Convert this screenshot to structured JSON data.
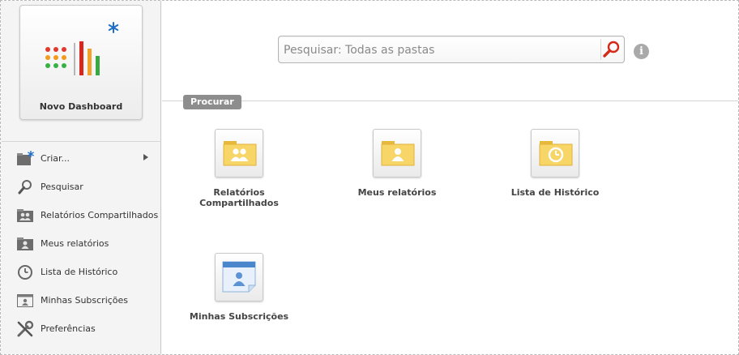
{
  "sidebar": {
    "dashboard_tile": {
      "label": "Novo Dashboard",
      "icon": "dashboard-chart-icon"
    },
    "menu": [
      {
        "label": "Criar...",
        "icon": "create-folder-icon",
        "has_submenu": true
      },
      {
        "label": "Pesquisar",
        "icon": "search-icon"
      },
      {
        "label": "Relatórios Compartilhados",
        "icon": "shared-reports-icon"
      },
      {
        "label": "Meus relatórios",
        "icon": "my-reports-icon"
      },
      {
        "label": "Lista de Histórico",
        "icon": "history-icon"
      },
      {
        "label": "Minhas Subscrições",
        "icon": "subscriptions-icon"
      },
      {
        "label": "Preferências",
        "icon": "preferences-icon"
      }
    ]
  },
  "search": {
    "placeholder": "Pesquisar: Todas as pastas",
    "value": "",
    "button_icon": "search-icon",
    "info_icon": "info-icon",
    "info_glyph": "i"
  },
  "browse": {
    "label": "Procurar",
    "tiles": [
      {
        "label": "Relatórios Compartilhados",
        "icon": "shared-reports-folder-icon"
      },
      {
        "label": "Meus relatórios",
        "icon": "my-reports-folder-icon"
      },
      {
        "label": "Lista de Histórico",
        "icon": "history-folder-icon"
      },
      {
        "label": "Minhas Subscrições",
        "icon": "subscriptions-icon"
      }
    ]
  },
  "colors": {
    "folder": "#f7d567",
    "folder_dark": "#e7b93a",
    "badge": "#8d8d8d",
    "accent_blue": "#1e6fc8",
    "search_red": "#d42a1a"
  }
}
